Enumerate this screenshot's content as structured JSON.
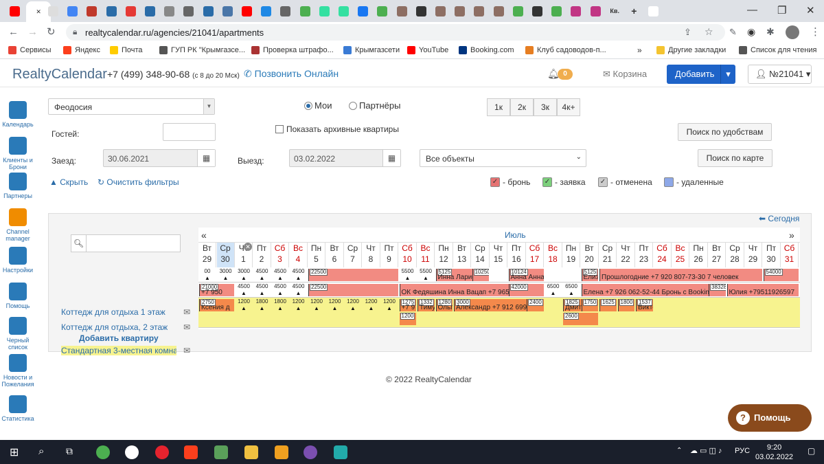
{
  "browser": {
    "url": "realtycalendar.ru/agencies/21041/apartments",
    "tab_icons": [
      "youtube",
      "close",
      "doc",
      "people",
      "home",
      "mail",
      "red",
      "mail",
      "circle",
      "photo",
      "mail",
      "vk",
      "youtube",
      "blue",
      "photo",
      "green",
      "tripadvisor",
      "tripadvisor",
      "facebook",
      "puzzle",
      "brown",
      "arrow",
      "brown",
      "brown",
      "brown",
      "brown",
      "chrome",
      "arrow",
      "chrome",
      "instagram",
      "instagram",
      "kv",
      "add",
      "google"
    ],
    "active_tab_label": "Кв.",
    "bookmarks": [
      {
        "label": "Сервисы",
        "color": "#e94235"
      },
      {
        "label": "Яндекс",
        "color": "#fc3f1d"
      },
      {
        "label": "Почта",
        "color": "#ffcc00"
      },
      {
        "label": "ГУП РК \"Крымгазсе...",
        "color": "#555555"
      },
      {
        "label": "Проверка штрафо...",
        "color": "#a33"
      },
      {
        "label": "Крымгазсети",
        "color": "#3a7bd5"
      },
      {
        "label": "YouTube",
        "color": "#ff0000"
      },
      {
        "label": "Booking.com",
        "color": "#003580"
      },
      {
        "label": "Клуб садоводов-п...",
        "color": "#e67e22"
      },
      {
        "label": "Другие закладки",
        "color": "#f4c430"
      },
      {
        "label": "Список для чтения",
        "color": "#555555"
      }
    ]
  },
  "header": {
    "logo": "RealtyCalendar",
    "phone": "+7 (499) 348-90-68",
    "phone_hours": "(с 8 до 20 Мск)",
    "call_online": "Позвонить Онлайн",
    "notifications": "0",
    "cart": "Корзина",
    "add_button": "Добавить",
    "account": "№21041"
  },
  "sidebar": [
    {
      "label": "Календарь",
      "color": "#2a7ab8"
    },
    {
      "label": "Клиенты и Брони",
      "color": "#2a7ab8"
    },
    {
      "label": "Партнеры",
      "color": "#2a7ab8"
    },
    {
      "label": "Channel manager",
      "color": "#f08c00"
    },
    {
      "label": "Настройки",
      "color": "#2a7ab8"
    },
    {
      "label": "Помощь",
      "color": "#2a7ab8"
    },
    {
      "label": "Черный список",
      "color": "#2a7ab8"
    },
    {
      "label": "Новости и Пожелания",
      "color": "#2a7ab8"
    },
    {
      "label": "Статистика",
      "color": "#2a7ab8"
    }
  ],
  "filters": {
    "city": "Феодосия",
    "mine": "Мои",
    "partners": "Партнёры",
    "rooms": [
      "1к",
      "2к",
      "3к",
      "4к+"
    ],
    "guests_label": "Гостей:",
    "show_archive": "Показать архивные квартиры",
    "search_amenities": "Поиск по удобствам",
    "checkin_label": "Заезд:",
    "checkin": "30.06.2021",
    "checkout_label": "Выезд:",
    "checkout": "03.02.2022",
    "objects": "Все объекты",
    "search_map": "Поиск по карте",
    "hide": "Скрыть",
    "clear": "Очистить фильтры"
  },
  "legend": [
    {
      "label": "- бронь",
      "color": "#e57373",
      "mark": "✓"
    },
    {
      "label": "- заявка",
      "color": "#7cd07c",
      "mark": "✓"
    },
    {
      "label": "- отменена",
      "color": "#cccccc",
      "mark": "✓"
    },
    {
      "label": "- удаленные",
      "color": "#8ea8e8",
      "mark": ""
    }
  ],
  "calendar": {
    "today": "Сегодня",
    "month": "Июль",
    "add_apartment": "Добавить квартиру",
    "days": [
      {
        "wd": "Вт",
        "d": "29",
        "we": false
      },
      {
        "wd": "Ср",
        "d": "30",
        "we": false
      },
      {
        "wd": "Чт",
        "d": "1",
        "we": false
      },
      {
        "wd": "Пт",
        "d": "2",
        "we": false
      },
      {
        "wd": "Сб",
        "d": "3",
        "we": true
      },
      {
        "wd": "Вс",
        "d": "4",
        "we": true
      },
      {
        "wd": "Пн",
        "d": "5",
        "we": false
      },
      {
        "wd": "Вт",
        "d": "6",
        "we": false
      },
      {
        "wd": "Ср",
        "d": "7",
        "we": false
      },
      {
        "wd": "Чт",
        "d": "8",
        "we": false
      },
      {
        "wd": "Пт",
        "d": "9",
        "we": false
      },
      {
        "wd": "Сб",
        "d": "10",
        "we": true
      },
      {
        "wd": "Вс",
        "d": "11",
        "we": true
      },
      {
        "wd": "Пн",
        "d": "12",
        "we": false
      },
      {
        "wd": "Вт",
        "d": "13",
        "we": false
      },
      {
        "wd": "Ср",
        "d": "14",
        "we": false
      },
      {
        "wd": "Чт",
        "d": "15",
        "we": false
      },
      {
        "wd": "Пт",
        "d": "16",
        "we": false
      },
      {
        "wd": "Сб",
        "d": "17",
        "we": true
      },
      {
        "wd": "Вс",
        "d": "18",
        "we": true
      },
      {
        "wd": "Пн",
        "d": "19",
        "we": false
      },
      {
        "wd": "Вт",
        "d": "20",
        "we": false
      },
      {
        "wd": "Ср",
        "d": "21",
        "we": false
      },
      {
        "wd": "Чт",
        "d": "22",
        "we": false
      },
      {
        "wd": "Пт",
        "d": "23",
        "we": false
      },
      {
        "wd": "Сб",
        "d": "24",
        "we": true
      },
      {
        "wd": "Вс",
        "d": "25",
        "we": true
      },
      {
        "wd": "Пн",
        "d": "26",
        "we": false
      },
      {
        "wd": "Вт",
        "d": "27",
        "we": false
      },
      {
        "wd": "Ср",
        "d": "28",
        "we": false
      },
      {
        "wd": "Чт",
        "d": "29",
        "we": false
      },
      {
        "wd": "Пт",
        "d": "30",
        "we": false
      },
      {
        "wd": "Сб",
        "d": "31",
        "we": true
      }
    ],
    "apartments": [
      {
        "name": "Коттедж для отдыха 1 этаж",
        "prices": [
          "00",
          "3000",
          "3000",
          "4500",
          "4500",
          "4500",
          "",
          "",
          "",
          "",
          "",
          "5500",
          "5500",
          "5000",
          "",
          "",
          "",
          "",
          "",
          "",
          "",
          "",
          "",
          "",
          "",
          "",
          "",
          "",
          "",
          "",
          "",
          "",
          "600"
        ],
        "bookings": [
          {
            "label": "",
            "tag": "22500",
            "start": 6,
            "span": 5,
            "color": "#f28b82"
          },
          {
            "label": "Инна Лариса +7",
            "tag": "5125",
            "start": 13,
            "span": 3,
            "color": "#f28b82"
          },
          {
            "label": "",
            "tag": "10250",
            "start": 15,
            "span": 1,
            "color": "#f28b82"
          },
          {
            "label": "Анна Анна",
            "tag": "10124",
            "start": 17,
            "span": 2,
            "color": "#f28b82"
          },
          {
            "label": "Елиз",
            "tag": "5125",
            "start": 21,
            "span": 1,
            "color": "#f28b82"
          },
          {
            "label": "Прошлогодние +7 920 807-73-30 7 человек",
            "tag": "",
            "start": 22,
            "span": 9,
            "color": "#f28b82"
          },
          {
            "label": "",
            "tag": "54000",
            "start": 31,
            "span": 2,
            "color": "#f28b82"
          }
        ]
      },
      {
        "name": "Коттедж для отдыха, 2 этаж",
        "prices": [
          "",
          "",
          "4500",
          "4500",
          "4500",
          "4500",
          "",
          "",
          "",
          "",
          "",
          "",
          "",
          "",
          "",
          "",
          "",
          "",
          "",
          "6500",
          "6500",
          "",
          "",
          "",
          "",
          "",
          "",
          "",
          "",
          "",
          "",
          "",
          ""
        ],
        "bookings": [
          {
            "label": "+7 950",
            "tag": "21000",
            "start": 0,
            "span": 2,
            "color": "#f28b82"
          },
          {
            "label": "",
            "tag": "22500",
            "start": 6,
            "span": 5,
            "color": "#f28b82"
          },
          {
            "label": "ОК Федяшина Инна Вацап +7 965 726-52-6",
            "tag": "",
            "start": 11,
            "span": 7,
            "color": "#f28b82"
          },
          {
            "label": "",
            "tag": "42000",
            "start": 17,
            "span": 2,
            "color": "#f28b82"
          },
          {
            "label": "Елена +7 926 062-52-44 Бронь с Booking.com",
            "tag": "",
            "start": 21,
            "span": 8,
            "color": "#f28b82"
          },
          {
            "label": "",
            "tag": "38328",
            "start": 28,
            "span": 1,
            "color": "#f28b82"
          },
          {
            "label": "Юлия +79511926597",
            "tag": "",
            "start": 29,
            "span": 4,
            "color": "#f28b82"
          }
        ]
      },
      {
        "name": "Стандартная 3-местная комната",
        "prices": [
          "",
          "",
          "1200",
          "1800",
          "1800",
          "1200",
          "1200",
          "1200",
          "1200",
          "1200",
          "1200",
          "1200",
          "",
          "",
          "",
          "",
          "",
          "",
          "",
          "",
          "",
          "",
          "",
          "",
          "",
          "",
          "",
          "",
          "",
          "",
          "",
          "",
          ""
        ],
        "bookings": [
          {
            "label": "Ксения д",
            "tag": "2750",
            "start": 0,
            "span": 2,
            "color": "#f4894b"
          },
          {
            "label": "+7 9",
            "tag": "1275",
            "start": 11,
            "span": 1,
            "color": "#f4894b"
          },
          {
            "label": "Тимуров",
            "tag": "1332",
            "start": 12,
            "span": 1,
            "color": "#f4894b"
          },
          {
            "label": "Ольга",
            "tag": "1280",
            "start": 13,
            "span": 1,
            "color": "#f4894b"
          },
          {
            "label": "Александр +7 912 699-56-69",
            "tag": "3000",
            "start": 14,
            "span": 5,
            "color": "#f4894b"
          },
          {
            "label": "",
            "tag": "2400",
            "start": 18,
            "span": 1,
            "color": "#f4894b"
          },
          {
            "label": "Дмитрий Козаев",
            "tag": "1825",
            "start": 20,
            "span": 2,
            "color": "#f4894b"
          },
          {
            "label": "",
            "tag": "1750",
            "start": 21,
            "span": 1,
            "color": "#f4894b"
          },
          {
            "label": "",
            "tag": "1625",
            "start": 22,
            "span": 1,
            "color": "#f4894b"
          },
          {
            "label": "",
            "tag": "1800",
            "start": 23,
            "span": 1,
            "color": "#f4894b"
          },
          {
            "label": "Викто",
            "tag": "1537",
            "start": 24,
            "span": 1,
            "color": "#f4894b"
          }
        ],
        "sub_bookings": [
          {
            "tag": "1200",
            "start": 11,
            "span": 1
          },
          {
            "tag": "2600",
            "start": 20,
            "span": 2
          }
        ]
      }
    ]
  },
  "footer": "© 2022 RealtyCalendar",
  "help_button": "Помощь",
  "taskbar": {
    "lang": "РУС",
    "time": "9:20",
    "date": "03.02.2022"
  }
}
